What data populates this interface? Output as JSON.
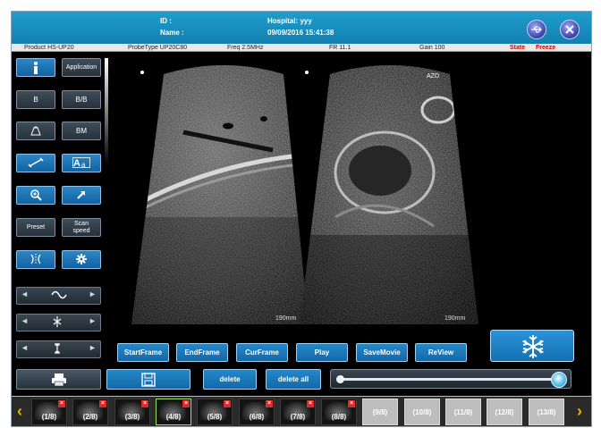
{
  "header": {
    "id_label": "ID :",
    "name_label": "Name :",
    "hospital": "Hospital: yyy",
    "datetime": "09/09/2016 15:41:38"
  },
  "params": {
    "product": "Product   HS-UP20",
    "probe": "ProbeType   UP20C80",
    "freq": "Freq   2.5MHz",
    "fr": "FR   11.1",
    "gain": "Gain   100",
    "state_label": "State",
    "state_value": "Freeze"
  },
  "left_panel": {
    "application": "Application",
    "mode_b": "B",
    "mode_bb": "B/B",
    "mode_bm": "BM",
    "preset": "Preset",
    "scan_speed_1": "Scan",
    "scan_speed_2": "speed"
  },
  "images": {
    "left_depth": "190mm",
    "right_depth": "190mm",
    "right_marker": "AZD"
  },
  "actions": {
    "start_frame": "StartFrame",
    "end_frame": "EndFrame",
    "cur_frame": "CurFrame",
    "play": "Play",
    "save_movie": "SaveMovie",
    "review": "ReView",
    "delete": "delete",
    "delete_all": "delete all"
  },
  "cine": {
    "position_fraction": 1.0
  },
  "thumbnails": [
    {
      "label": "(1/8)",
      "filled": true,
      "selected": false
    },
    {
      "label": "(2/8)",
      "filled": true,
      "selected": false
    },
    {
      "label": "(3/8)",
      "filled": true,
      "selected": false
    },
    {
      "label": "(4/8)",
      "filled": true,
      "selected": true
    },
    {
      "label": "(5/8)",
      "filled": true,
      "selected": false
    },
    {
      "label": "(6/8)",
      "filled": true,
      "selected": false
    },
    {
      "label": "(7/8)",
      "filled": true,
      "selected": false
    },
    {
      "label": "(8/8)",
      "filled": true,
      "selected": false
    },
    {
      "label": "(9/8)",
      "filled": false,
      "selected": false
    },
    {
      "label": "(10/8)",
      "filled": false,
      "selected": false
    },
    {
      "label": "(11/8)",
      "filled": false,
      "selected": false
    },
    {
      "label": "(12/8)",
      "filled": false,
      "selected": false
    },
    {
      "label": "(13/8)",
      "filled": false,
      "selected": false
    }
  ],
  "colors": {
    "header": "#1a8fc0",
    "button_blue": "#1b78bb",
    "state_red": "#d40000",
    "strip_arrow": "#e8b400"
  }
}
